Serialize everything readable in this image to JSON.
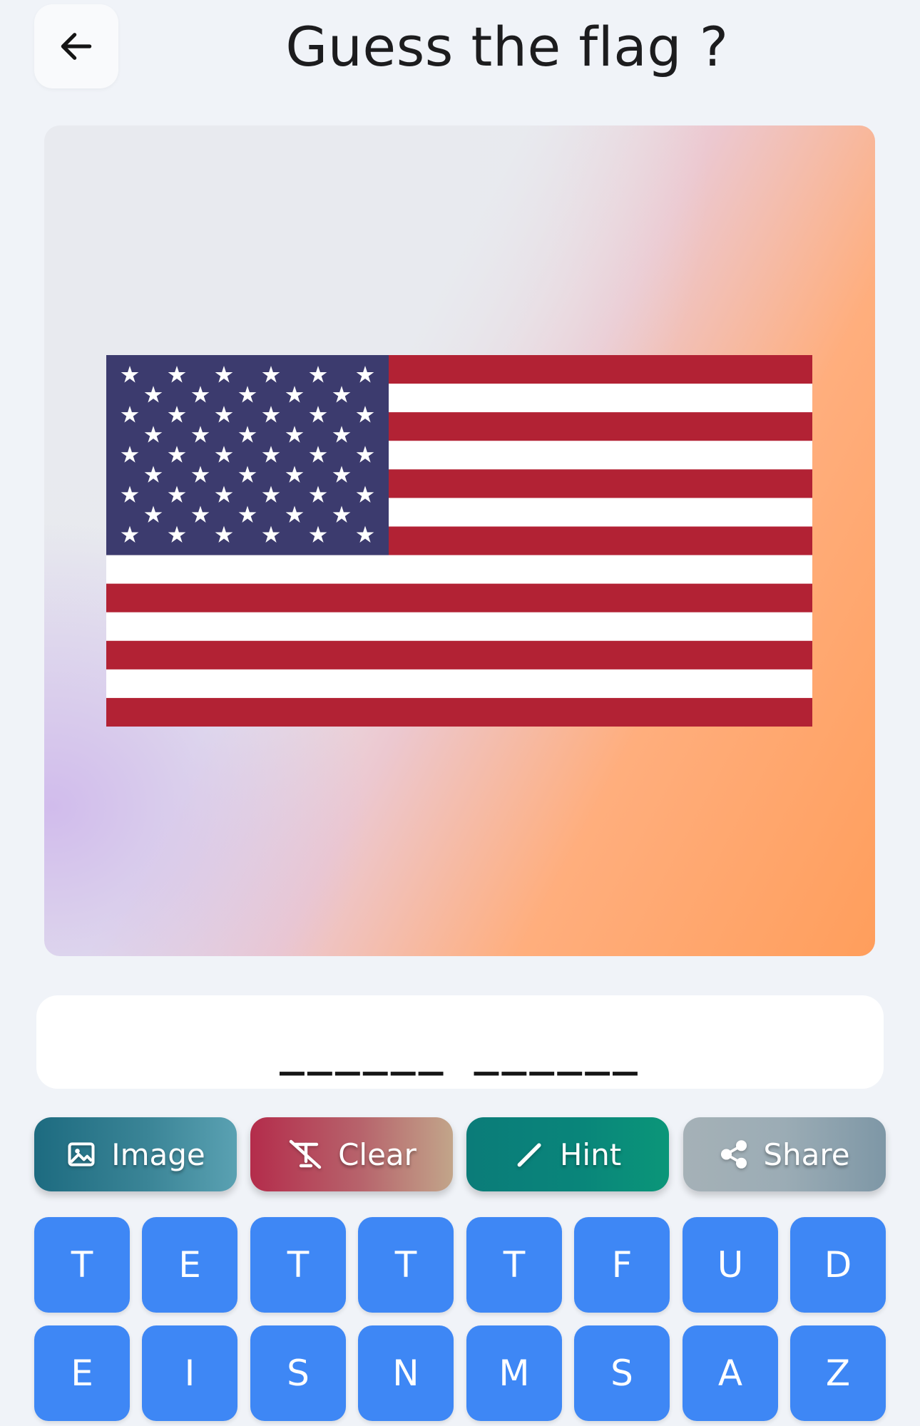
{
  "header": {
    "title": "Guess the flag ?"
  },
  "flag": {
    "colors": {
      "red": "#b22234",
      "white": "#ffffff",
      "blue": "#3c3b6e"
    }
  },
  "answer": {
    "display": "______ ______"
  },
  "actions": [
    {
      "label": "Image",
      "icon": "image-icon"
    },
    {
      "label": "Clear",
      "icon": "clear-format-icon"
    },
    {
      "label": "Hint",
      "icon": "pencil-icon"
    },
    {
      "label": "Share",
      "icon": "share-icon"
    }
  ],
  "keyboard": {
    "row1": [
      "T",
      "E",
      "T",
      "T",
      "T",
      "F",
      "U",
      "D"
    ],
    "row2": [
      "E",
      "I",
      "S",
      "N",
      "M",
      "S",
      "A",
      "Z"
    ]
  },
  "colors": {
    "background": "#f0f3f8",
    "key": "#3e87f5"
  }
}
